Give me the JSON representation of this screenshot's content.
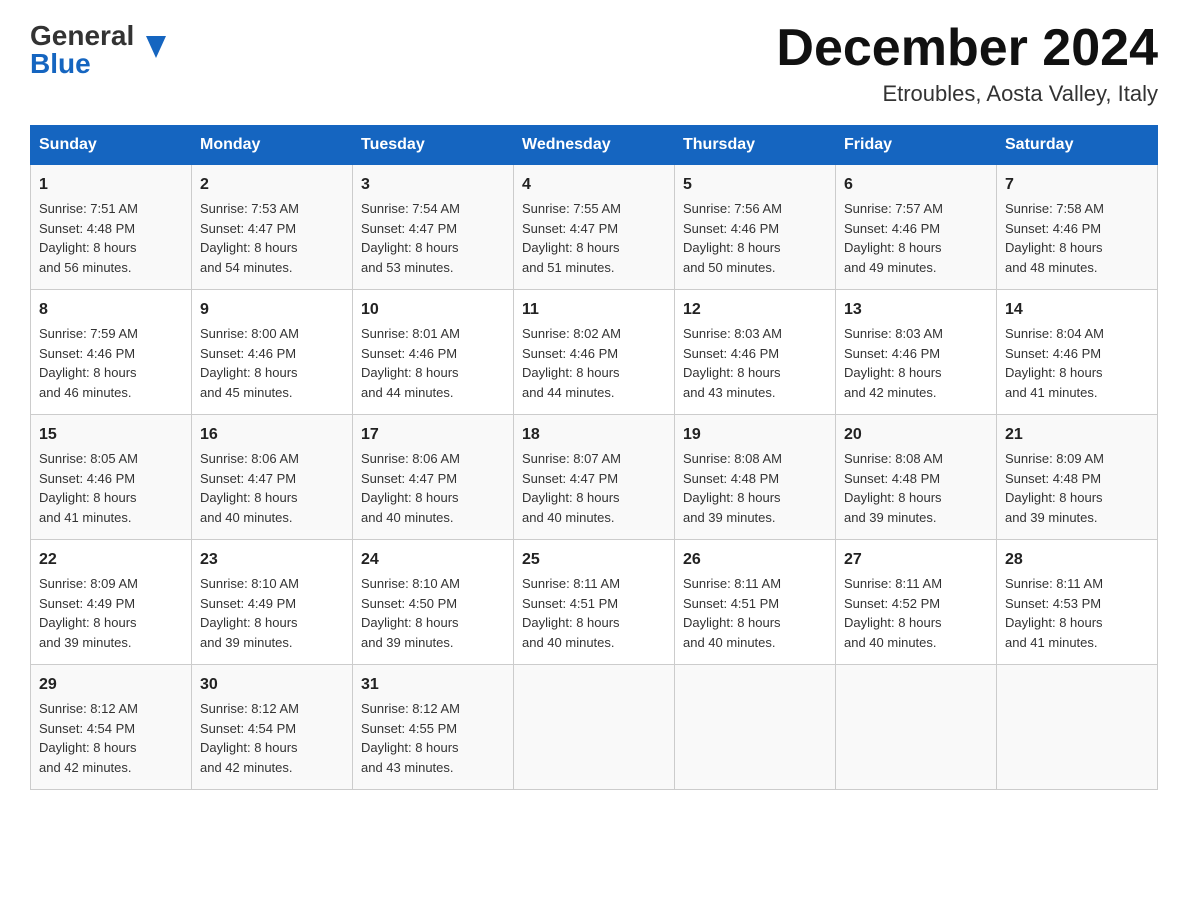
{
  "header": {
    "logo_line1": "General",
    "logo_line2": "Blue",
    "title": "December 2024",
    "subtitle": "Etroubles, Aosta Valley, Italy"
  },
  "days_of_week": [
    "Sunday",
    "Monday",
    "Tuesday",
    "Wednesday",
    "Thursday",
    "Friday",
    "Saturday"
  ],
  "weeks": [
    [
      {
        "day": "1",
        "sunrise": "7:51 AM",
        "sunset": "4:48 PM",
        "daylight": "8 hours and 56 minutes."
      },
      {
        "day": "2",
        "sunrise": "7:53 AM",
        "sunset": "4:47 PM",
        "daylight": "8 hours and 54 minutes."
      },
      {
        "day": "3",
        "sunrise": "7:54 AM",
        "sunset": "4:47 PM",
        "daylight": "8 hours and 53 minutes."
      },
      {
        "day": "4",
        "sunrise": "7:55 AM",
        "sunset": "4:47 PM",
        "daylight": "8 hours and 51 minutes."
      },
      {
        "day": "5",
        "sunrise": "7:56 AM",
        "sunset": "4:46 PM",
        "daylight": "8 hours and 50 minutes."
      },
      {
        "day": "6",
        "sunrise": "7:57 AM",
        "sunset": "4:46 PM",
        "daylight": "8 hours and 49 minutes."
      },
      {
        "day": "7",
        "sunrise": "7:58 AM",
        "sunset": "4:46 PM",
        "daylight": "8 hours and 48 minutes."
      }
    ],
    [
      {
        "day": "8",
        "sunrise": "7:59 AM",
        "sunset": "4:46 PM",
        "daylight": "8 hours and 46 minutes."
      },
      {
        "day": "9",
        "sunrise": "8:00 AM",
        "sunset": "4:46 PM",
        "daylight": "8 hours and 45 minutes."
      },
      {
        "day": "10",
        "sunrise": "8:01 AM",
        "sunset": "4:46 PM",
        "daylight": "8 hours and 44 minutes."
      },
      {
        "day": "11",
        "sunrise": "8:02 AM",
        "sunset": "4:46 PM",
        "daylight": "8 hours and 44 minutes."
      },
      {
        "day": "12",
        "sunrise": "8:03 AM",
        "sunset": "4:46 PM",
        "daylight": "8 hours and 43 minutes."
      },
      {
        "day": "13",
        "sunrise": "8:03 AM",
        "sunset": "4:46 PM",
        "daylight": "8 hours and 42 minutes."
      },
      {
        "day": "14",
        "sunrise": "8:04 AM",
        "sunset": "4:46 PM",
        "daylight": "8 hours and 41 minutes."
      }
    ],
    [
      {
        "day": "15",
        "sunrise": "8:05 AM",
        "sunset": "4:46 PM",
        "daylight": "8 hours and 41 minutes."
      },
      {
        "day": "16",
        "sunrise": "8:06 AM",
        "sunset": "4:47 PM",
        "daylight": "8 hours and 40 minutes."
      },
      {
        "day": "17",
        "sunrise": "8:06 AM",
        "sunset": "4:47 PM",
        "daylight": "8 hours and 40 minutes."
      },
      {
        "day": "18",
        "sunrise": "8:07 AM",
        "sunset": "4:47 PM",
        "daylight": "8 hours and 40 minutes."
      },
      {
        "day": "19",
        "sunrise": "8:08 AM",
        "sunset": "4:48 PM",
        "daylight": "8 hours and 39 minutes."
      },
      {
        "day": "20",
        "sunrise": "8:08 AM",
        "sunset": "4:48 PM",
        "daylight": "8 hours and 39 minutes."
      },
      {
        "day": "21",
        "sunrise": "8:09 AM",
        "sunset": "4:48 PM",
        "daylight": "8 hours and 39 minutes."
      }
    ],
    [
      {
        "day": "22",
        "sunrise": "8:09 AM",
        "sunset": "4:49 PM",
        "daylight": "8 hours and 39 minutes."
      },
      {
        "day": "23",
        "sunrise": "8:10 AM",
        "sunset": "4:49 PM",
        "daylight": "8 hours and 39 minutes."
      },
      {
        "day": "24",
        "sunrise": "8:10 AM",
        "sunset": "4:50 PM",
        "daylight": "8 hours and 39 minutes."
      },
      {
        "day": "25",
        "sunrise": "8:11 AM",
        "sunset": "4:51 PM",
        "daylight": "8 hours and 40 minutes."
      },
      {
        "day": "26",
        "sunrise": "8:11 AM",
        "sunset": "4:51 PM",
        "daylight": "8 hours and 40 minutes."
      },
      {
        "day": "27",
        "sunrise": "8:11 AM",
        "sunset": "4:52 PM",
        "daylight": "8 hours and 40 minutes."
      },
      {
        "day": "28",
        "sunrise": "8:11 AM",
        "sunset": "4:53 PM",
        "daylight": "8 hours and 41 minutes."
      }
    ],
    [
      {
        "day": "29",
        "sunrise": "8:12 AM",
        "sunset": "4:54 PM",
        "daylight": "8 hours and 42 minutes."
      },
      {
        "day": "30",
        "sunrise": "8:12 AM",
        "sunset": "4:54 PM",
        "daylight": "8 hours and 42 minutes."
      },
      {
        "day": "31",
        "sunrise": "8:12 AM",
        "sunset": "4:55 PM",
        "daylight": "8 hours and 43 minutes."
      },
      null,
      null,
      null,
      null
    ]
  ]
}
